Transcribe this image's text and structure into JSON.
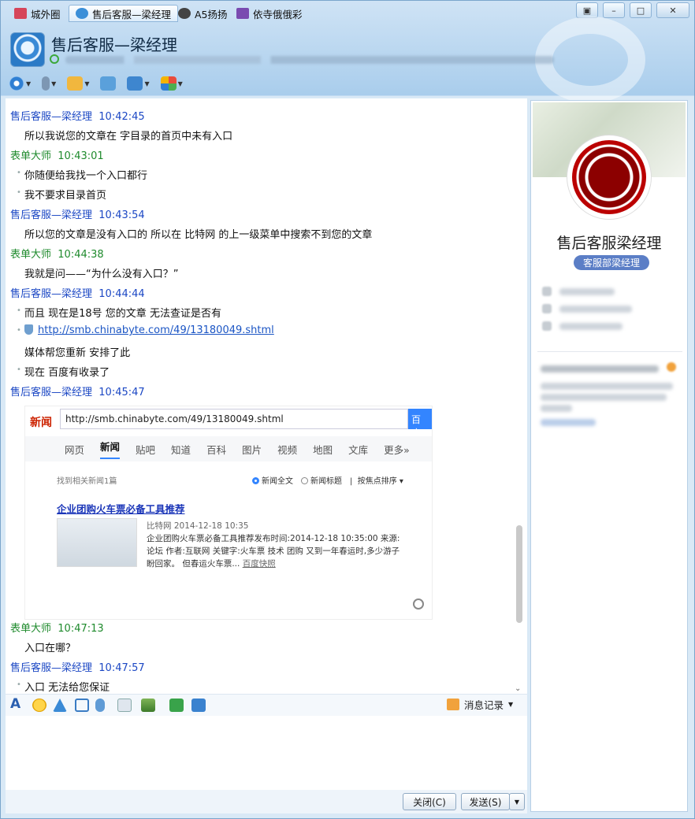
{
  "tabs": [
    {
      "label": "城外圈",
      "color": "#d6455a"
    },
    {
      "label": "售后客服—梁经理",
      "color": "#3b8fd8"
    },
    {
      "label": "A5扬扬",
      "color": "#444444"
    },
    {
      "label": "依寺俄俄彩",
      "color": "#7a4bb0"
    }
  ],
  "window": {
    "minimize": "–",
    "maximize": "□",
    "close": "✕",
    "skin": "▣"
  },
  "header": {
    "contact_name": "售后客服—梁经理"
  },
  "toolbar": [
    {
      "icon": "video-icon"
    },
    {
      "icon": "microphone-icon"
    },
    {
      "icon": "send-file-icon"
    },
    {
      "icon": "message-add-icon"
    },
    {
      "icon": "remote-desktop-icon"
    },
    {
      "icon": "apps-icon"
    }
  ],
  "messages": [
    {
      "type": "header",
      "sender": "售后客服—梁经理",
      "time": "10:42:45",
      "side": "blue"
    },
    {
      "type": "text",
      "text": "所以我说您的文章在 字目录的首页中未有入口"
    },
    {
      "type": "header",
      "sender": "表单大师",
      "time": "10:43:01",
      "side": "green"
    },
    {
      "type": "text",
      "bullet": true,
      "text": "你随便给我找一个入口都行"
    },
    {
      "type": "text",
      "bullet": true,
      "text": "我不要求目录首页"
    },
    {
      "type": "header",
      "sender": "售后客服—梁经理",
      "time": "10:43:54",
      "side": "blue"
    },
    {
      "type": "text",
      "text": "所以您的文章是没有入口的  所以在 比特网 的上一级菜单中搜索不到您的文章"
    },
    {
      "type": "header",
      "sender": "表单大师",
      "time": "10:44:38",
      "side": "green"
    },
    {
      "type": "text",
      "text": "我就是问——“为什么没有入口？”"
    },
    {
      "type": "header",
      "sender": "售后客服—梁经理",
      "time": "10:44:44",
      "side": "blue"
    },
    {
      "type": "text",
      "bullet": true,
      "text": "而且  现在是18号    您的文章 无法查证是否有"
    },
    {
      "type": "link",
      "bullet": true,
      "text": "http://smb.chinabyte.com/49/13180049.shtml"
    },
    {
      "type": "text",
      "text": "媒体帮您重新 安排了此"
    },
    {
      "type": "text",
      "bullet": true,
      "text": "现在 百度有收录了"
    },
    {
      "type": "header",
      "sender": "售后客服—梁经理",
      "time": "10:45:47",
      "side": "blue"
    },
    {
      "type": "header",
      "sender": "表单大师",
      "time": "10:47:13",
      "side": "green"
    },
    {
      "type": "text",
      "text": "入口在哪？"
    },
    {
      "type": "header",
      "sender": "售后客服—梁经理",
      "time": "10:47:57",
      "side": "blue"
    },
    {
      "type": "text",
      "bullet": true,
      "text": "入口  无法给您保证"
    }
  ],
  "screenshot": {
    "logo": "新闻",
    "url": "http://smb.chinabyte.com/49/13180049.shtml",
    "search_button": "百度",
    "tabs": [
      "网页",
      "新闻",
      "贴吧",
      "知道",
      "百科",
      "图片",
      "视频",
      "地图",
      "文库",
      "更多»"
    ],
    "active_tab": "新闻",
    "found": "找到相关新闻1篇",
    "opt_full": "新闻全文",
    "opt_title": "新闻标题",
    "opt_sort": "按焦点排序",
    "result_title": "企业团购火车票必备工具推荐",
    "result_source": "比特网  2014-12-18 10:35",
    "result_body": "企业团购火车票必备工具推荐发布时间:2014-12-18 10:35:00 来源:论坛 作者:互联网 关键字:火车票 技术 团购 又到一年春运时,多少游子盼回家。 但春运火车票...",
    "result_cache": "百度快照"
  },
  "input_toolbar": {
    "history_label": "消息记录"
  },
  "buttons": {
    "close": "关闭(C)",
    "send": "发送(S)"
  },
  "profile": {
    "name": "售后客服梁经理",
    "tag": "客服部梁经理"
  }
}
